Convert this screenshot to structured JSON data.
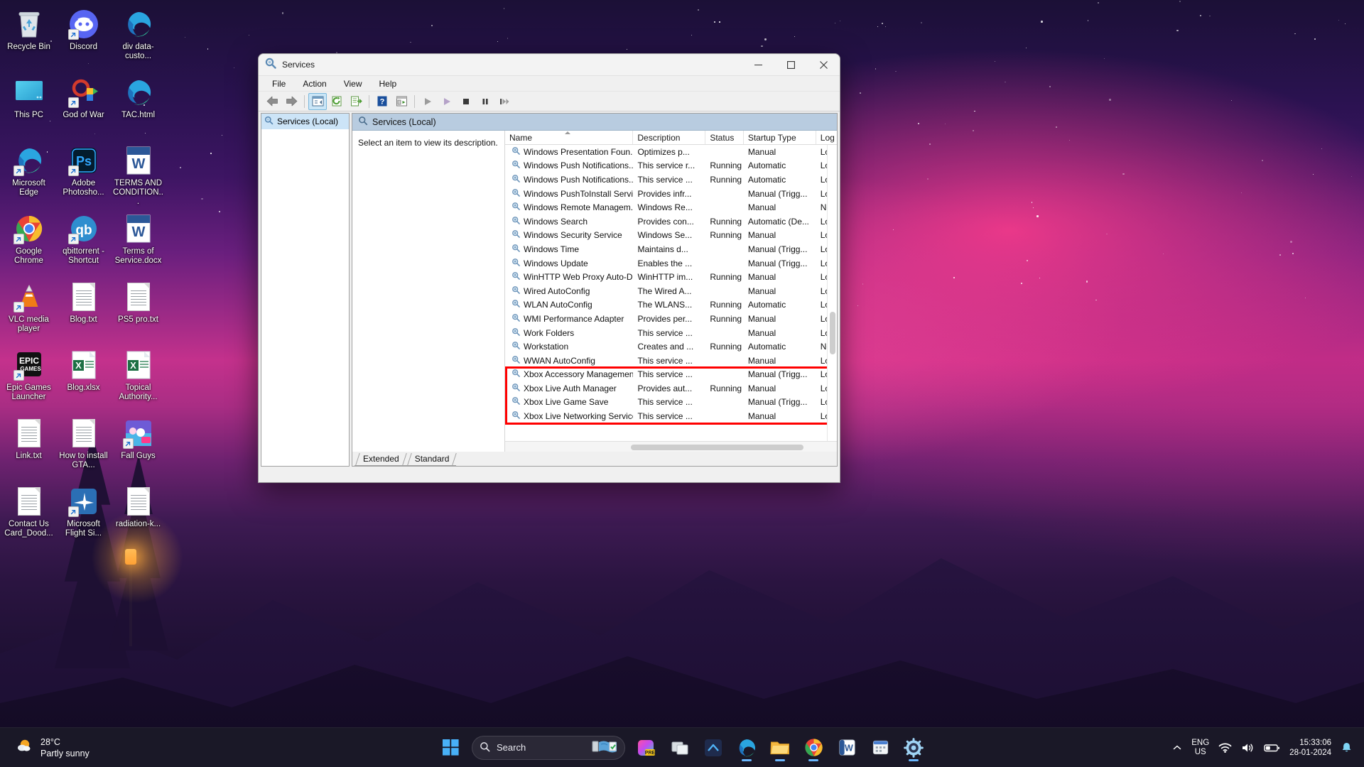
{
  "desktop": {
    "icons": [
      {
        "label": "Recycle Bin",
        "icon": "recycle-bin-icon",
        "shortcut": false
      },
      {
        "label": "Discord",
        "icon": "discord-icon",
        "shortcut": true
      },
      {
        "label": "div data-custo...",
        "icon": "edge-html-file-icon",
        "shortcut": false
      },
      {
        "label": "This PC",
        "icon": "this-pc-icon",
        "shortcut": false
      },
      {
        "label": "God of War",
        "icon": "god-of-war-icon",
        "shortcut": true
      },
      {
        "label": "TAC.html",
        "icon": "edge-html-file-icon",
        "shortcut": false
      },
      {
        "label": "Microsoft Edge",
        "icon": "edge-icon",
        "shortcut": true
      },
      {
        "label": "Adobe Photosho...",
        "icon": "photoshop-icon",
        "shortcut": true
      },
      {
        "label": "TERMS AND CONDITION...",
        "icon": "word-doc-icon",
        "shortcut": false
      },
      {
        "label": "Google Chrome",
        "icon": "chrome-icon",
        "shortcut": true
      },
      {
        "label": "qbittorrent - Shortcut",
        "icon": "qbittorrent-icon",
        "shortcut": true
      },
      {
        "label": "Terms of Service.docx",
        "icon": "word-doc-icon",
        "shortcut": false
      },
      {
        "label": "VLC media player",
        "icon": "vlc-icon",
        "shortcut": true
      },
      {
        "label": "Blog.txt",
        "icon": "text-file-icon",
        "shortcut": false
      },
      {
        "label": "PS5 pro.txt",
        "icon": "text-file-icon",
        "shortcut": false
      },
      {
        "label": "Epic Games Launcher",
        "icon": "epic-games-icon",
        "shortcut": true
      },
      {
        "label": "Blog.xlsx",
        "icon": "excel-file-icon",
        "shortcut": false
      },
      {
        "label": "Topical Authority...",
        "icon": "excel-file-icon",
        "shortcut": false
      },
      {
        "label": "Link.txt",
        "icon": "text-file-icon",
        "shortcut": false
      },
      {
        "label": "How to install GTA...",
        "icon": "text-file-icon",
        "shortcut": false
      },
      {
        "label": "Fall Guys",
        "icon": "fall-guys-icon",
        "shortcut": true
      },
      {
        "label": "Contact Us Card_Dood...",
        "icon": "text-file-icon",
        "shortcut": false
      },
      {
        "label": "Microsoft Flight Si...",
        "icon": "flight-simulator-icon",
        "shortcut": true
      },
      {
        "label": "radiation-k...",
        "icon": "text-file-icon",
        "shortcut": false
      }
    ]
  },
  "window": {
    "title": "Services",
    "minimize_label": "─",
    "maximize_label": "☐",
    "close_label": "✕",
    "menu": [
      "File",
      "Action",
      "View",
      "Help"
    ],
    "tree": {
      "node_label": "Services (Local)"
    },
    "pane_header": "Services (Local)",
    "description_prompt": "Select an item to view its description.",
    "tabs": [
      {
        "label": "Extended",
        "active": false
      },
      {
        "label": "Standard",
        "active": true
      }
    ],
    "columns": [
      "Name",
      "Description",
      "Status",
      "Startup Type",
      "Log"
    ],
    "rows": [
      {
        "name": "Windows Presentation Foun...",
        "desc": "Optimizes p...",
        "status": "",
        "startup": "Manual",
        "logon": "Loc"
      },
      {
        "name": "Windows Push Notifications...",
        "desc": "This service r...",
        "status": "Running",
        "startup": "Automatic",
        "logon": "Loc"
      },
      {
        "name": "Windows Push Notifications...",
        "desc": "This service ...",
        "status": "Running",
        "startup": "Automatic",
        "logon": "Loc"
      },
      {
        "name": "Windows PushToInstall Servi...",
        "desc": "Provides infr...",
        "status": "",
        "startup": "Manual (Trigg...",
        "logon": "Loc"
      },
      {
        "name": "Windows Remote Managem...",
        "desc": "Windows Re...",
        "status": "",
        "startup": "Manual",
        "logon": "Ne"
      },
      {
        "name": "Windows Search",
        "desc": "Provides con...",
        "status": "Running",
        "startup": "Automatic (De...",
        "logon": "Loc"
      },
      {
        "name": "Windows Security Service",
        "desc": "Windows Se...",
        "status": "Running",
        "startup": "Manual",
        "logon": "Loc"
      },
      {
        "name": "Windows Time",
        "desc": "Maintains d...",
        "status": "",
        "startup": "Manual (Trigg...",
        "logon": "Loc"
      },
      {
        "name": "Windows Update",
        "desc": "Enables the ...",
        "status": "",
        "startup": "Manual (Trigg...",
        "logon": "Loc"
      },
      {
        "name": "WinHTTP Web Proxy Auto-D...",
        "desc": "WinHTTP im...",
        "status": "Running",
        "startup": "Manual",
        "logon": "Loc"
      },
      {
        "name": "Wired AutoConfig",
        "desc": "The Wired A...",
        "status": "",
        "startup": "Manual",
        "logon": "Loc"
      },
      {
        "name": "WLAN AutoConfig",
        "desc": "The WLANS...",
        "status": "Running",
        "startup": "Automatic",
        "logon": "Loc"
      },
      {
        "name": "WMI Performance Adapter",
        "desc": "Provides per...",
        "status": "Running",
        "startup": "Manual",
        "logon": "Loc"
      },
      {
        "name": "Work Folders",
        "desc": "This service ...",
        "status": "",
        "startup": "Manual",
        "logon": "Loc"
      },
      {
        "name": "Workstation",
        "desc": "Creates and ...",
        "status": "Running",
        "startup": "Automatic",
        "logon": "Ne"
      },
      {
        "name": "WWAN AutoConfig",
        "desc": "This service ...",
        "status": "",
        "startup": "Manual",
        "logon": "Loc"
      },
      {
        "name": "Xbox Accessory Managemen...",
        "desc": "This service ...",
        "status": "",
        "startup": "Manual (Trigg...",
        "logon": "Loc"
      },
      {
        "name": "Xbox Live Auth Manager",
        "desc": "Provides aut...",
        "status": "Running",
        "startup": "Manual",
        "logon": "Loc"
      },
      {
        "name": "Xbox Live Game Save",
        "desc": "This service ...",
        "status": "",
        "startup": "Manual (Trigg...",
        "logon": "Loc"
      },
      {
        "name": "Xbox Live Networking Service",
        "desc": "This service ...",
        "status": "",
        "startup": "Manual",
        "logon": "Loc"
      }
    ],
    "highlight": {
      "first_row_index": 16,
      "row_count": 4,
      "color": "#ff0000"
    }
  },
  "taskbar": {
    "weather": {
      "temperature": "28°C",
      "condition": "Partly sunny"
    },
    "search_placeholder": "Search",
    "apps": [
      {
        "name": "start-button",
        "running": false
      },
      {
        "name": "task-view-button",
        "running": false
      },
      {
        "name": "copilot-button",
        "running": false
      },
      {
        "name": "widgets-button",
        "running": false
      },
      {
        "name": "file-explorer-dark-button",
        "running": false
      },
      {
        "name": "vscode-button",
        "running": false
      },
      {
        "name": "edge-button",
        "running": true
      },
      {
        "name": "file-explorer-button",
        "running": true
      },
      {
        "name": "chrome-button",
        "running": true
      },
      {
        "name": "word-button",
        "running": false
      },
      {
        "name": "calendar-button",
        "running": false
      },
      {
        "name": "settings-button",
        "running": true
      }
    ],
    "tray": {
      "show_hidden_label": "⌃",
      "language_line1": "ENG",
      "language_line2": "US",
      "time": "15:33:06",
      "date": "28-01-2024"
    }
  }
}
